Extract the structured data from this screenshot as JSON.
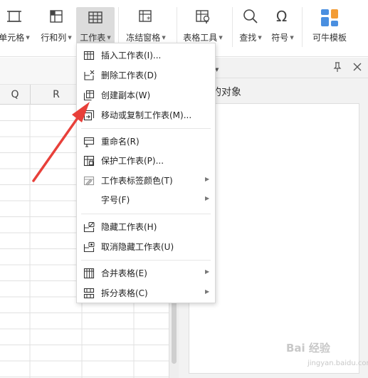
{
  "ribbon": {
    "items": [
      {
        "label": "单元格",
        "icon": "cell-icon",
        "dropdown": true
      },
      {
        "label": "行和列",
        "icon": "rows-cols-icon",
        "dropdown": true
      },
      {
        "label": "工作表",
        "icon": "worksheet-icon",
        "dropdown": true,
        "active": true
      },
      {
        "label": "冻结窗格",
        "icon": "freeze-panes-icon",
        "dropdown": true
      },
      {
        "label": "表格工具",
        "icon": "table-tools-icon",
        "dropdown": true
      },
      {
        "label": "查找",
        "icon": "search-icon",
        "dropdown": true
      },
      {
        "label": "符号",
        "icon": "omega-icon",
        "dropdown": true
      },
      {
        "label": "可牛模板",
        "icon": "template-icon",
        "dropdown": false
      }
    ]
  },
  "sheet": {
    "columns": [
      "Q",
      "R"
    ]
  },
  "pane": {
    "title_fragment": "格",
    "subtitle": "中的对象"
  },
  "context_menu": {
    "items": [
      {
        "label": "插入工作表(I)...",
        "icon": "insert-sheet-icon",
        "submenu": false
      },
      {
        "label": "删除工作表(D)",
        "icon": "delete-sheet-icon",
        "submenu": false
      },
      {
        "label": "创建副本(W)",
        "icon": "copy-sheet-icon",
        "submenu": false
      },
      {
        "label": "移动或复制工作表(M)...",
        "icon": "move-copy-sheet-icon",
        "submenu": false
      },
      {
        "label": "重命名(R)",
        "icon": "rename-icon",
        "submenu": false
      },
      {
        "label": "保护工作表(P)...",
        "icon": "protect-sheet-icon",
        "submenu": false
      },
      {
        "label": "工作表标签颜色(T)",
        "icon": "tab-color-icon",
        "submenu": true
      },
      {
        "label": "字号(F)",
        "icon": "",
        "submenu": true
      },
      {
        "label": "隐藏工作表(H)",
        "icon": "hide-sheet-icon",
        "submenu": false
      },
      {
        "label": "取消隐藏工作表(U)",
        "icon": "unhide-sheet-icon",
        "submenu": false
      },
      {
        "label": "合并表格(E)",
        "icon": "merge-tables-icon",
        "submenu": true
      },
      {
        "label": "拆分表格(C)",
        "icon": "split-table-icon",
        "submenu": true
      }
    ]
  },
  "watermark": {
    "text": "Bai 经验",
    "sub": "jingyan.baidu.com"
  },
  "colors": {
    "annotation_arrow": "#e8403a",
    "active_tab_bg": "#dcdcdc",
    "template_icon_blue": "#4a8fe0",
    "template_icon_orange": "#f39c34"
  }
}
